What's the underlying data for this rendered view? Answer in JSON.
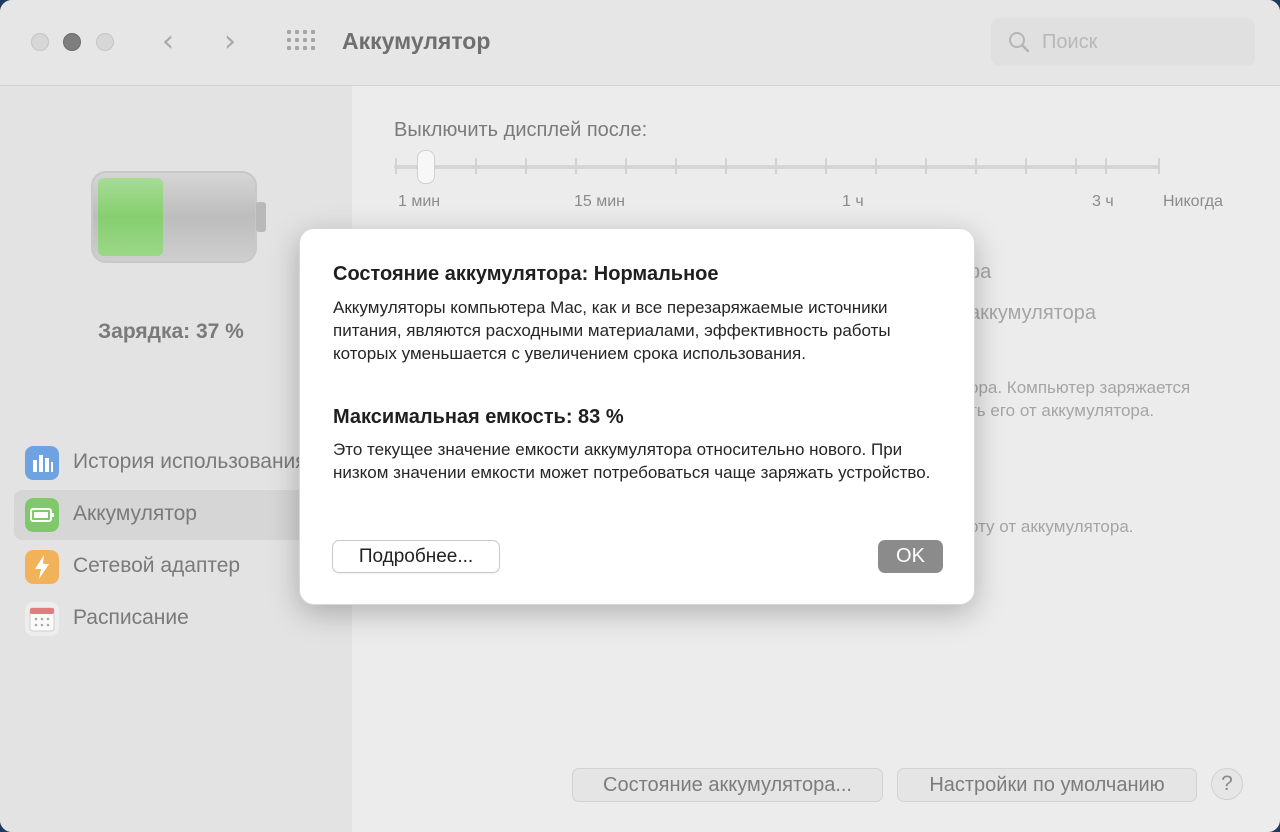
{
  "window": {
    "title": "Аккумулятор",
    "search_placeholder": "Поиск"
  },
  "sidebar": {
    "charge_text": "Зарядка: 37 %",
    "charge_level": 0.37,
    "items": [
      {
        "label": "История использования",
        "icon": "usage-history-icon",
        "color": "#4a8fe0"
      },
      {
        "label": "Аккумулятор",
        "icon": "battery-icon",
        "color": "#63c04a"
      },
      {
        "label": "Сетевой адаптер",
        "icon": "power-adapter-icon",
        "color": "#f0a53a"
      },
      {
        "label": "Расписание",
        "icon": "calendar-icon",
        "color": "#e8e8e8"
      }
    ]
  },
  "main": {
    "display_off_label": "Выключить дисплей после:",
    "slider_labels": [
      "1 мин",
      "15 мин",
      "1 ч",
      "3 ч",
      "Никогда"
    ],
    "background_fragments": [
      "ра",
      "аккумулятора",
      "ора. Компьютер заряжается",
      "ть его от аккумулятора.",
      "оту от аккумулятора."
    ]
  },
  "buttons": {
    "battery_health": "Состояние аккумулятора...",
    "restore_defaults": "Настройки по умолчанию",
    "help": "?"
  },
  "dialog": {
    "heading1": "Состояние аккумулятора: Нормальное",
    "body1": "Аккумуляторы компьютера Mac, как и все перезаряжаемые источники питания, являются расходными материалами, эффективность работы которых уменьшается с увеличением срока использования.",
    "heading2": "Максимальная емкость: 83 %",
    "body2": "Это текущее значение емкости аккумулятора относительно нового. При низком значении емкости может потребоваться чаще заряжать устройство.",
    "more_button": "Подробнее...",
    "ok_button": "OK"
  }
}
